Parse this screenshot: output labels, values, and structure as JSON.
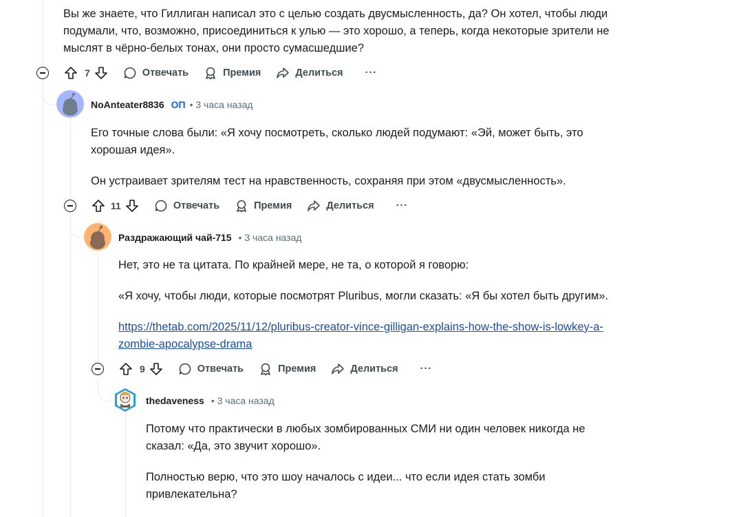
{
  "comment0": {
    "lines": [
      "Вы же знаете, что Гиллиган написал это с целью создать двусмысленность, да? Он хотел, чтобы люди",
      "подумали, что, возможно, присоединиться к улью — это хорошо, а теперь, когда некоторые зрители не",
      "мыслят в чёрно-белых тонах, они просто сумасшедшие?"
    ],
    "votes": "7"
  },
  "comment1": {
    "author": "NoAnteater8836",
    "op_badge": "ОП",
    "time": "• 3 часа назад",
    "p1_lines": [
      "Его точные слова были: «Я хочу посмотреть, сколько людей подумают: «Эй, может быть, это",
      "хорошая идея»."
    ],
    "p2": "Он устраивает зрителям тест на нравственность, сохраняя при этом «двусмысленность».",
    "votes": "11"
  },
  "comment2": {
    "author": "Раздражающий чай-715",
    "time": "• 3 часа назад",
    "p1": "Нет, это не та цитата. По крайней мере, не та, о которой я говорю:",
    "p2": "«Я хочу, чтобы люди, которые посмотрят Pluribus, могли сказать: «Я бы хотел быть другим».",
    "link_lines": [
      "https://thetab.com/2025/11/12/pluribus-creator-vince-gilligan-explains-how-the-show-is-lowkey-a-",
      "zombie-apocalypse-drama"
    ],
    "votes": "9"
  },
  "comment3": {
    "author": "thedaveness",
    "time": "• 3 часа назад",
    "p1_lines": [
      "Потому что практически в любых зомбированных СМИ ни один человек никогда не",
      "сказал: «Да, это звучит хорошо»."
    ],
    "p2_lines": [
      "Полностью верю, что это шоу началось с идеи... что если идея стать зомби",
      "привлекательна?"
    ]
  },
  "actions": {
    "reply": "Отвечать",
    "award": "Премия",
    "share": "Делиться",
    "more": "···"
  },
  "colors": {
    "link": "#1a4ea1",
    "op": "#0f63d6",
    "meta": "#576f76",
    "thread": "#e5ebee"
  },
  "icons": [
    "collapse-icon",
    "upvote-icon",
    "downvote-icon",
    "comment-icon",
    "award-icon",
    "share-icon",
    "more-icon"
  ]
}
